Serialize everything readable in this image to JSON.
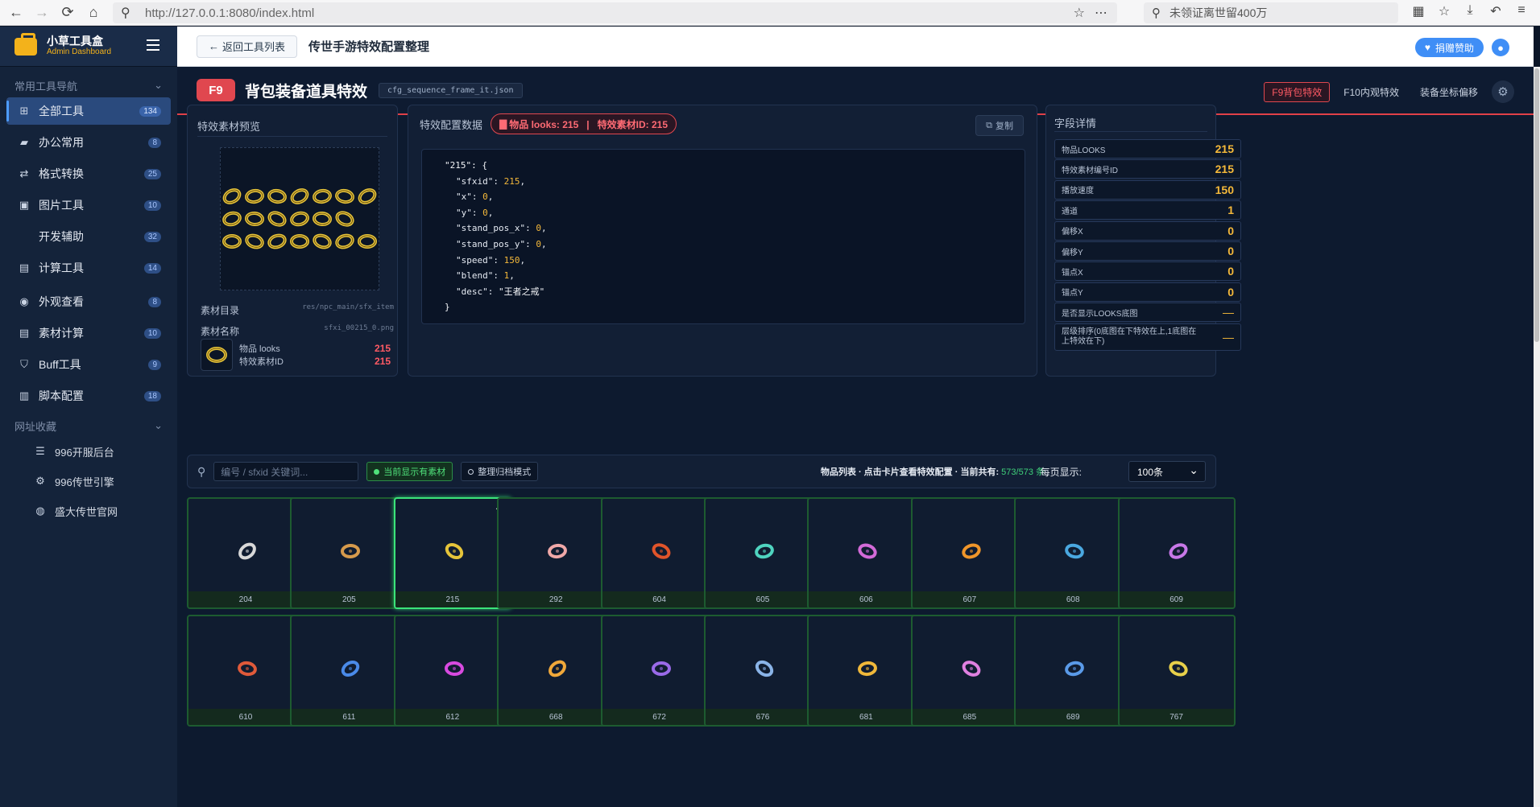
{
  "browser": {
    "url": "http://127.0.0.1:8080/index.html",
    "search_text": "未领证离世留400万"
  },
  "sidebar": {
    "brand_title": "小草工具盒",
    "brand_sub": "Admin Dashboard",
    "section_tools": "常用工具导航",
    "items": [
      {
        "label": "全部工具",
        "count": "134",
        "icon": "grid-icon"
      },
      {
        "label": "办公常用",
        "count": "8",
        "icon": "briefcase-icon"
      },
      {
        "label": "格式转换",
        "count": "25",
        "icon": "swap-icon"
      },
      {
        "label": "图片工具",
        "count": "10",
        "icon": "image-icon"
      },
      {
        "label": "开发辅助",
        "count": "32",
        "icon": "code-icon"
      },
      {
        "label": "计算工具",
        "count": "14",
        "icon": "calculator-icon"
      },
      {
        "label": "外观查看",
        "count": "8",
        "icon": "eye-icon"
      },
      {
        "label": "素材计算",
        "count": "10",
        "icon": "calculator-icon"
      },
      {
        "label": "Buff工具",
        "count": "9",
        "icon": "shield-icon"
      },
      {
        "label": "脚本配置",
        "count": "18",
        "icon": "file-icon"
      }
    ],
    "section_links": "网址收藏",
    "links": [
      {
        "label": "996开服后台",
        "icon": "server-icon"
      },
      {
        "label": "996传世引擎",
        "icon": "gear-icon"
      },
      {
        "label": "盛大传世官网",
        "icon": "globe-icon"
      }
    ]
  },
  "topbar": {
    "back_label": "返回工具列表",
    "title": "传世手游特效配置整理",
    "donate_label": "捐赠赞助"
  },
  "header": {
    "key": "F9",
    "title": "背包装备道具特效",
    "file": "cfg_sequence_frame_it.json",
    "tabs": [
      "F9背包特效",
      "F10内观特效",
      "装备坐标偏移"
    ]
  },
  "preview": {
    "title": "特效素材预览",
    "dir_label": "素材目录",
    "dir_value": "res/npc_main/sfx_item",
    "name_label": "素材名称",
    "name_value": "sfxi_00215_0.png",
    "looks_label": "物品 looks",
    "looks_value": "215",
    "sfx_label": "特效素材ID",
    "sfx_value": "215"
  },
  "config": {
    "title": "特效配置数据",
    "tag": "物品 looks: 215   |   特效素材ID: 215",
    "copy_label": "复制",
    "code": [
      {
        "t": "\"215\": {",
        "ind": 0
      },
      {
        "k": "\"sfxid\"",
        "v": "215",
        "ind": 1
      },
      {
        "k": "\"x\"",
        "v": "0",
        "ind": 1
      },
      {
        "k": "\"y\"",
        "v": "0",
        "ind": 1
      },
      {
        "k": "\"stand_pos_x\"",
        "v": "0",
        "ind": 1
      },
      {
        "k": "\"stand_pos_y\"",
        "v": "0",
        "ind": 1
      },
      {
        "k": "\"speed\"",
        "v": "150",
        "ind": 1
      },
      {
        "k": "\"blend\"",
        "v": "1",
        "ind": 1
      },
      {
        "k": "\"desc\"",
        "s": "\"王者之戒\"",
        "ind": 1
      },
      {
        "t": "}",
        "ind": 0
      }
    ]
  },
  "fields": {
    "title": "字段详情",
    "rows": [
      {
        "label": "物品LOOKS",
        "value": "215"
      },
      {
        "label": "特效素材编号ID",
        "value": "215"
      },
      {
        "label": "播放速度",
        "value": "150"
      },
      {
        "label": "通道",
        "value": "1"
      },
      {
        "label": "偏移X",
        "value": "0"
      },
      {
        "label": "偏移Y",
        "value": "0"
      },
      {
        "label": "锚点X",
        "value": "0"
      },
      {
        "label": "锚点Y",
        "value": "0"
      },
      {
        "label": "是否显示LOOKS底图",
        "value": "—"
      },
      {
        "label": "层级排序(0底图在下特效在上,1底图在上特效在下)",
        "value": "—"
      }
    ]
  },
  "list": {
    "search_placeholder": "编号 / sfxid 关键词...",
    "chip_on": "当前显示有素材",
    "chip_off": "整理归档模式",
    "stat_prefix": "物品列表 · 点击卡片查看特效配置 · 当前共有:",
    "stat_count": "573/573 条",
    "per_page_label": "每页显示:",
    "per_page_value": "100条",
    "items": [
      {
        "id": "204",
        "color": "#d8d8d8"
      },
      {
        "id": "205",
        "color": "#d69a4c"
      },
      {
        "id": "215",
        "color": "#e5c43a",
        "selected": true
      },
      {
        "id": "292",
        "color": "#f0a8a8"
      },
      {
        "id": "604",
        "color": "#e0542a"
      },
      {
        "id": "605",
        "color": "#4fd4c0"
      },
      {
        "id": "606",
        "color": "#d36ad8"
      },
      {
        "id": "607",
        "color": "#f0962a"
      },
      {
        "id": "608",
        "color": "#4aa8e0"
      },
      {
        "id": "609",
        "color": "#c878e8"
      },
      {
        "id": "610",
        "color": "#e05a3a"
      },
      {
        "id": "611",
        "color": "#4a8ae8"
      },
      {
        "id": "612",
        "color": "#d84ae0"
      },
      {
        "id": "668",
        "color": "#f0a83a"
      },
      {
        "id": "672",
        "color": "#9a6ae8"
      },
      {
        "id": "676",
        "color": "#8ab4e8"
      },
      {
        "id": "681",
        "color": "#f0b83a"
      },
      {
        "id": "685",
        "color": "#e080e0"
      },
      {
        "id": "689",
        "color": "#5a9ae8"
      },
      {
        "id": "767",
        "color": "#e8d04a"
      }
    ]
  }
}
